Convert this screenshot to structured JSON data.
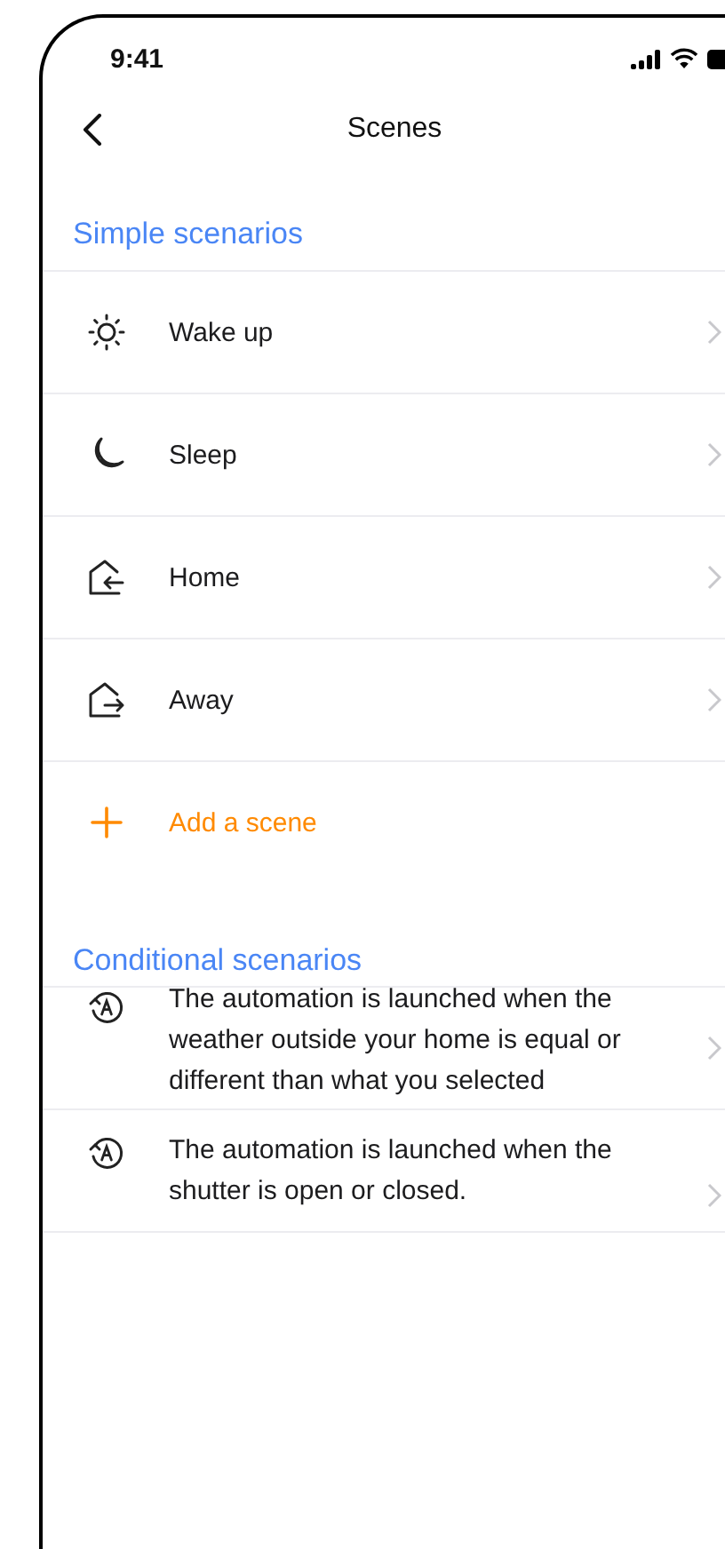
{
  "status_bar": {
    "time": "9:41"
  },
  "header": {
    "title": "Scenes"
  },
  "sections": [
    {
      "title": "Simple scenarios",
      "items": [
        {
          "kind": "sun",
          "label": "Wake up"
        },
        {
          "kind": "moon",
          "label": "Sleep"
        },
        {
          "kind": "arrive",
          "label": "Home"
        },
        {
          "kind": "leave",
          "label": "Away"
        },
        {
          "kind": "add",
          "label": "Add a scene"
        }
      ]
    },
    {
      "title": "Conditional scenarios",
      "items": [
        {
          "kind": "automation",
          "label": "The automation is launched when the weather outside your home is equal or different than what you selected"
        },
        {
          "kind": "automation",
          "label": "The automation is launched when the shutter is open or closed."
        }
      ]
    }
  ]
}
